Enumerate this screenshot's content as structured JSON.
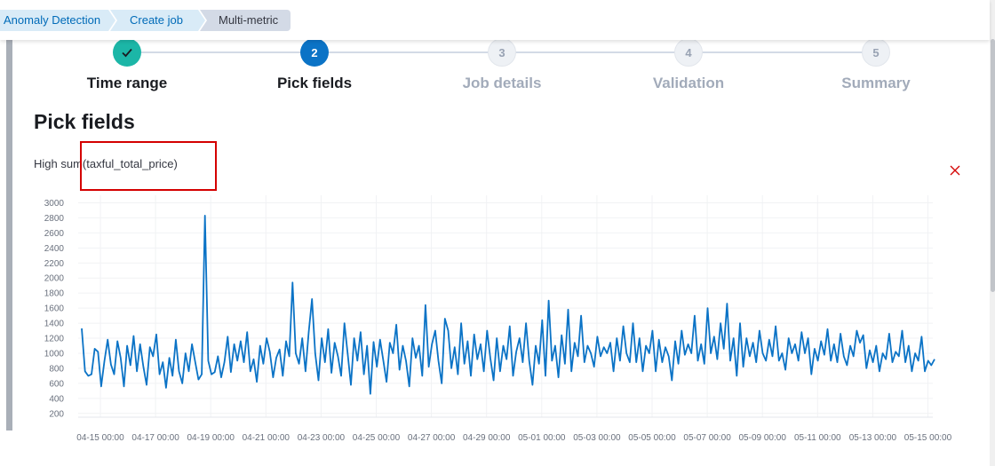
{
  "breadcrumbs": [
    {
      "label": "Anomaly Detection"
    },
    {
      "label": "Create job"
    },
    {
      "label": "Multi-metric"
    }
  ],
  "steps": [
    {
      "number": "",
      "title": "Time range",
      "status": "complete"
    },
    {
      "number": "2",
      "title": "Pick fields",
      "status": "current"
    },
    {
      "number": "3",
      "title": "Job details",
      "status": "disabled"
    },
    {
      "number": "4",
      "title": "Validation",
      "status": "disabled"
    },
    {
      "number": "5",
      "title": "Summary",
      "status": "disabled"
    }
  ],
  "page_title": "Pick fields",
  "detector_title": "High sum(taxful_total_price)",
  "close_icon": "cross-icon",
  "colors": {
    "line": "#0b73c6",
    "complete_step": "#1cb6a7",
    "current_step": "#0b73c6",
    "highlight_box": "#d40000",
    "remove_icon": "#d40000"
  },
  "chart_data": {
    "type": "line",
    "title": "",
    "xlabel": "",
    "ylabel": "",
    "ylim": [
      150,
      3100
    ],
    "y_ticks": [
      "200",
      "400",
      "600",
      "800",
      "1000",
      "1200",
      "1400",
      "1600",
      "1800",
      "2000",
      "2200",
      "2400",
      "2600",
      "2800",
      "3000"
    ],
    "x_ticks": [
      "04-15 00:00",
      "04-17 00:00",
      "04-19 00:00",
      "04-21 00:00",
      "04-23 00:00",
      "04-25 00:00",
      "04-27 00:00",
      "04-29 00:00",
      "05-01 00:00",
      "05-03 00:00",
      "05-05 00:00",
      "05-07 00:00",
      "05-09 00:00",
      "05-11 00:00",
      "05-13 00:00",
      "05-15 00:00"
    ],
    "series": [
      {
        "name": "",
        "x_start": "04-14 12:00",
        "x_end": "05-15 12:00",
        "values": [
          1330,
          760,
          700,
          720,
          1060,
          1020,
          560,
          900,
          1180,
          850,
          720,
          1160,
          940,
          560,
          1100,
          840,
          1230,
          760,
          1120,
          820,
          580,
          1080,
          960,
          1250,
          720,
          880,
          540,
          940,
          700,
          1180,
          760,
          600,
          1000,
          760,
          1120,
          880,
          650,
          720,
          2830,
          900,
          720,
          750,
          960,
          680,
          880,
          1220,
          750,
          1120,
          900,
          1160,
          880,
          1280,
          760,
          920,
          620,
          1100,
          860,
          1200,
          1020,
          680,
          940,
          1050,
          700,
          1160,
          960,
          1940,
          1000,
          860,
          1200,
          760,
          1280,
          1720,
          1000,
          640,
          1200,
          880,
          1320,
          740,
          1140,
          960,
          700,
          1400,
          1000,
          580,
          1200,
          900,
          1280,
          720,
          1100,
          460,
          1150,
          820,
          1180,
          900,
          620,
          1140,
          1000,
          1380,
          780,
          1100,
          900,
          560,
          1200,
          940,
          1100,
          700,
          1640,
          820,
          1120,
          1300,
          900,
          600,
          1460,
          1300,
          800,
          1080,
          720,
          1400,
          860,
          1160,
          700,
          1250,
          920,
          1120,
          760,
          1300,
          940,
          640,
          1200,
          760,
          1100,
          920,
          1360,
          700,
          1020,
          1200,
          880,
          1400,
          900,
          580,
          1100,
          860,
          1440,
          700,
          1700,
          900,
          1100,
          680,
          1240,
          860,
          1580,
          760,
          1140,
          960,
          1500,
          880,
          1100,
          1000,
          820,
          1220,
          960,
          1080,
          1000,
          1140,
          760,
          1200,
          900,
          1360,
          1000,
          880,
          1400,
          880,
          1200,
          760,
          1100,
          1000,
          1300,
          760,
          1180,
          880,
          1080,
          960,
          640,
          1160,
          860,
          1300,
          980,
          1120,
          1000,
          1500,
          900,
          1120,
          860,
          1600,
          1000,
          1220,
          920,
          1400,
          1060,
          1660,
          900,
          1200,
          700,
          1400,
          820,
          1200,
          960,
          1140,
          880,
          1300,
          1000,
          900,
          1180,
          960,
          1360,
          900,
          1000,
          780,
          1200,
          1000,
          1120,
          900,
          1280,
          1000,
          1200,
          720,
          1060,
          900,
          1160,
          980,
          1320,
          900,
          1120,
          880,
          1260,
          960,
          840,
          1100,
          960,
          1300,
          1140,
          1240,
          800,
          1040,
          880,
          1100,
          760,
          1000,
          920,
          1260,
          880,
          1020,
          960,
          1300,
          880,
          1100,
          760,
          1000,
          900,
          1220,
          760,
          900,
          840,
          920
        ]
      }
    ]
  }
}
